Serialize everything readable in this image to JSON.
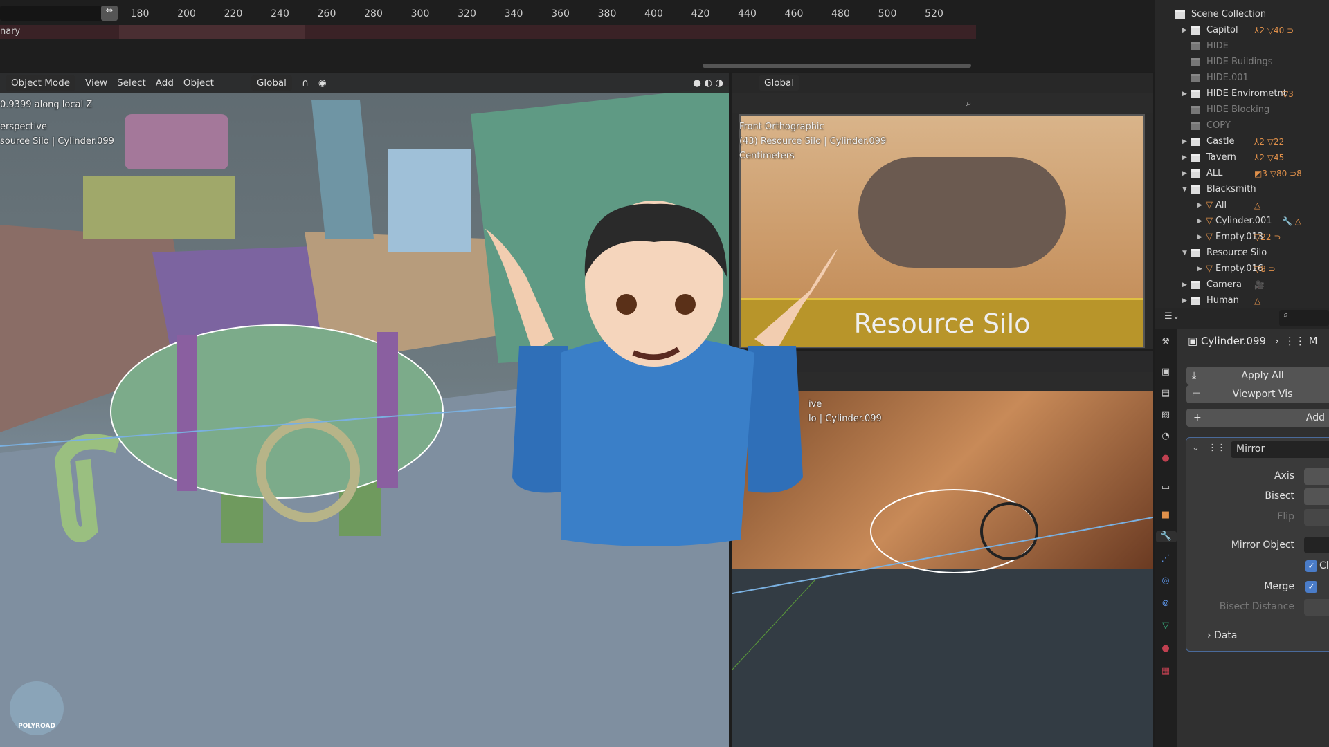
{
  "timeline": {
    "ticks": [
      "180",
      "200",
      "220",
      "240",
      "260",
      "280",
      "300",
      "320",
      "340",
      "360",
      "380",
      "400",
      "420",
      "440",
      "460",
      "480",
      "500",
      "520"
    ],
    "summary_label": "nary"
  },
  "left_viewport": {
    "header": {
      "mode": "Object Mode",
      "menus": [
        "View",
        "Select",
        "Add",
        "Object"
      ],
      "orientation": "Global"
    },
    "overlay": {
      "operation": "0.9399 along local Z",
      "view": "erspective",
      "object": "source Silo | Cylinder.099"
    },
    "logo_text": "POLYROAD"
  },
  "top_right_viewport": {
    "header": {
      "orientation": "Global"
    },
    "overlay": {
      "view": "Front Orthographic",
      "object": "(43) Resource Silo | Cylinder.099",
      "units": "Centimeters"
    },
    "reference_caption": "Resource Silo"
  },
  "bottom_right_viewport": {
    "overlay": {
      "view": "ive",
      "object": "lo | Cylinder.099"
    }
  },
  "outliner": {
    "items": [
      {
        "label": "Scene Collection",
        "indent": 0,
        "badges": ""
      },
      {
        "label": "Capitol",
        "indent": 1,
        "badges": "⅄2 ▽40 ⊃",
        "arrow": "▶"
      },
      {
        "label": "HIDE",
        "indent": 1,
        "dim": true
      },
      {
        "label": "HIDE Buildings",
        "indent": 1,
        "dim": true
      },
      {
        "label": "HIDE.001",
        "indent": 1,
        "dim": true
      },
      {
        "label": "HIDE Envirometnt",
        "indent": 1,
        "badges": "▽3",
        "arrow": "▶"
      },
      {
        "label": "HIDE Blocking",
        "indent": 1,
        "dim": true
      },
      {
        "label": "COPY",
        "indent": 1,
        "dim": true
      },
      {
        "label": "Castle",
        "indent": 1,
        "badges": "⅄2 ▽22",
        "arrow": "▶"
      },
      {
        "label": "Tavern",
        "indent": 1,
        "badges": "⅄2 ▽45",
        "arrow": "▶"
      },
      {
        "label": "ALL",
        "indent": 1,
        "badges": "◩3 ▽80 ⊃8",
        "arrow": "▶"
      },
      {
        "label": "Blacksmith",
        "indent": 1,
        "arrow": "▼"
      },
      {
        "label": "All",
        "indent": 2,
        "badges": "△",
        "arrow": "▶",
        "obj": true
      },
      {
        "label": "Cylinder.001",
        "indent": 2,
        "badges": "🔧 △",
        "arrow": "▶",
        "obj": true
      },
      {
        "label": "Empty.013",
        "indent": 2,
        "badges": "▽22 ⊃",
        "arrow": "▶",
        "obj": true
      },
      {
        "label": "Resource Silo",
        "indent": 1,
        "arrow": "▼"
      },
      {
        "label": "Empty.016",
        "indent": 2,
        "badges": "▽8 ⊃",
        "arrow": "▶",
        "obj": true
      },
      {
        "label": "Camera",
        "indent": 1,
        "badges": "🎥",
        "arrow": "▶"
      },
      {
        "label": "Human",
        "indent": 1,
        "badges": "△",
        "arrow": "▶"
      }
    ]
  },
  "properties": {
    "object_name": "Cylinder.099",
    "modifier_crumb": "M",
    "apply_all": "Apply All",
    "viewport_vis": "Viewport Vis",
    "add_modifier": "Add",
    "modifier_name": "Mirror",
    "fields": {
      "axis": "Axis",
      "bisect": "Bisect",
      "flip": "Flip",
      "mirror_object": "Mirror Object",
      "clipping": "Cl",
      "merge": "Merge",
      "bisect_distance": "Bisect Distance"
    },
    "data_panel": "Data",
    "clipping_checked": true,
    "merge_checked": true
  },
  "colors": {
    "accent": "#4a7cc8",
    "object_orange": "#e0904a",
    "data_green": "#3cc08a"
  }
}
